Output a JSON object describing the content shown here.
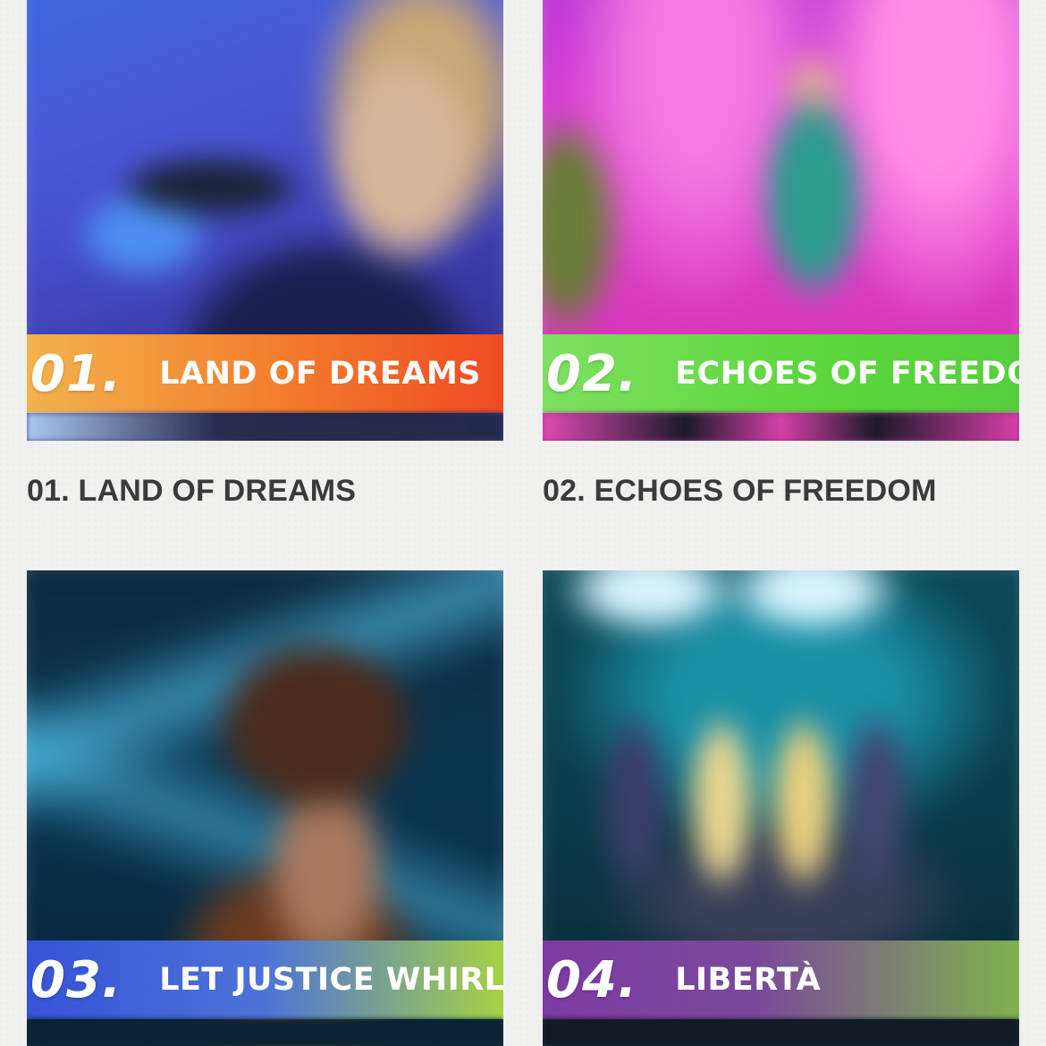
{
  "cards": [
    {
      "number": "01.",
      "banner_title": "LAND OF DREAMS",
      "caption": "01. LAND OF DREAMS"
    },
    {
      "number": "02.",
      "banner_title": "ECHOES OF FREEDOM",
      "caption": "02. ECHOES OF FREEDOM"
    },
    {
      "number": "03.",
      "banner_title": "LET JUSTICE WHIRL",
      "caption": ""
    },
    {
      "number": "04.",
      "banner_title": "LIBERTÀ",
      "caption": ""
    }
  ]
}
